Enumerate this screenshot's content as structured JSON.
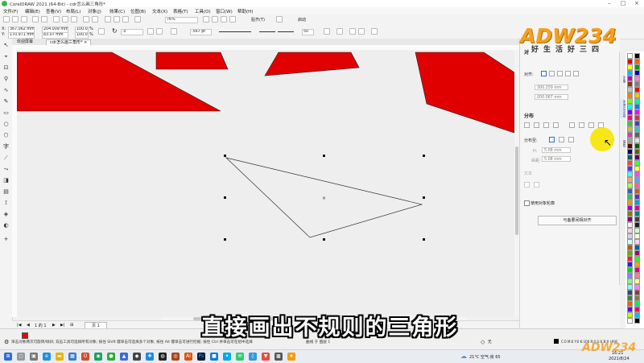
{
  "window": {
    "title": "CorelDRAW 2021 (64-Bit) - cdr怎么画三角形*"
  },
  "menubar": {
    "items": [
      "文件(F)",
      "编辑(E)",
      "查看(V)",
      "布局(L)",
      "对象(J)",
      "效果(C)",
      "位图(B)",
      "文本(X)",
      "表格(T)",
      "工具(O)",
      "窗口(W)",
      "帮助(H)"
    ]
  },
  "toolbar": {
    "zoom": "76%",
    "snap_label": "贴齐(T)",
    "launch_label": "启动"
  },
  "propertybar": {
    "x_label": "X:",
    "x_value": "367.062 mm",
    "y_label": "Y:",
    "y_value": "170.971 mm",
    "w_value": "204.009 mm",
    "h_value": "83.07 mm",
    "scale_x": "100.0",
    "scale_y": "100.0",
    "percent": "%",
    "angle": ".0",
    "outline_width": ".567 pt",
    "count": "50"
  },
  "tabs": {
    "welcome": "欢迎屏幕",
    "document": "cdr怎么画三角形*"
  },
  "panel": {
    "header_char": "对",
    "align_label": "对齐:",
    "align_x_value": "300.259 mm",
    "align_y_value": "200.067 mm",
    "distribute_title": "分布",
    "distribute_to_label": "分布至:",
    "h_label": "H:",
    "h_value": "5.08 mm",
    "v_label": "纵距:",
    "v_value": "5.08 mm",
    "text_title": "文本",
    "use_outline_label": "使用对象轮廓",
    "align_to_page_button": "与备要间相对齐"
  },
  "docker_tabs": [
    "对象",
    "对齐与分布",
    "属性"
  ],
  "pagenav": {
    "page_info": "1 的 1",
    "page_tab": "页 1"
  },
  "status": {
    "hint": "单击对象两次可旋转/倾斜; 双击工具可选择所有对象; 按住 Shift 键单击可选择多个对象; 按住 Alt 键单击可进行挖掘; 按住 Ctrl 并单击可在组中选择",
    "object_info": "曲线 于 图层 1",
    "fill_none": "无",
    "color_code": "C:0 M:0 Y:0 K:100 R:0 G:0 B:0 (#000000)",
    "outline_size": ".567 pt"
  },
  "taskbar": {
    "weather": "21°C  空气:良 65",
    "time": "16:21",
    "date": "2021/8/24"
  },
  "subtitle": "直接画出不规则的三角形",
  "watermark": "ADW234",
  "watermark_sub": "好生活好三四",
  "watermark_small": "ADW234",
  "colors": {
    "shape_red": "#e00000",
    "accent_blue": "#2a6fd6",
    "cursor_yellow": "#f7e600"
  }
}
